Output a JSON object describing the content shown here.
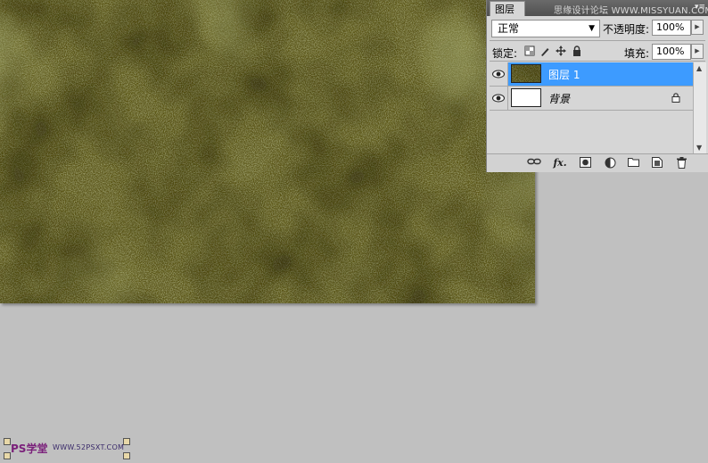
{
  "layers_panel": {
    "tab_title": "图层",
    "watermark": "思缘设计论坛 WWW.MISSYUAN.COM",
    "menu_icon": "panel-menu-icon",
    "blend_mode": "正常",
    "opacity_label": "不透明度:",
    "opacity_value": "100%",
    "lock_label": "锁定:",
    "fill_label": "填充:",
    "fill_value": "100%",
    "layers": [
      {
        "name": "图层 1",
        "visible": true,
        "selected": true,
        "thumbnail": "texture"
      },
      {
        "name": "背景",
        "visible": true,
        "selected": false,
        "locked": true,
        "thumbnail": "white"
      }
    ],
    "bottom_tools": [
      "link-icon",
      "fx-icon",
      "mask-icon",
      "adjustment-icon",
      "group-icon",
      "new-layer-icon",
      "trash-icon"
    ]
  },
  "logo": {
    "text": "PS学堂",
    "url": "WWW.52PSXT.COM"
  },
  "colors": {
    "workspace": "#c0c0c0",
    "selection": "#3d9bff",
    "texture_base": "#5e5a1e"
  }
}
